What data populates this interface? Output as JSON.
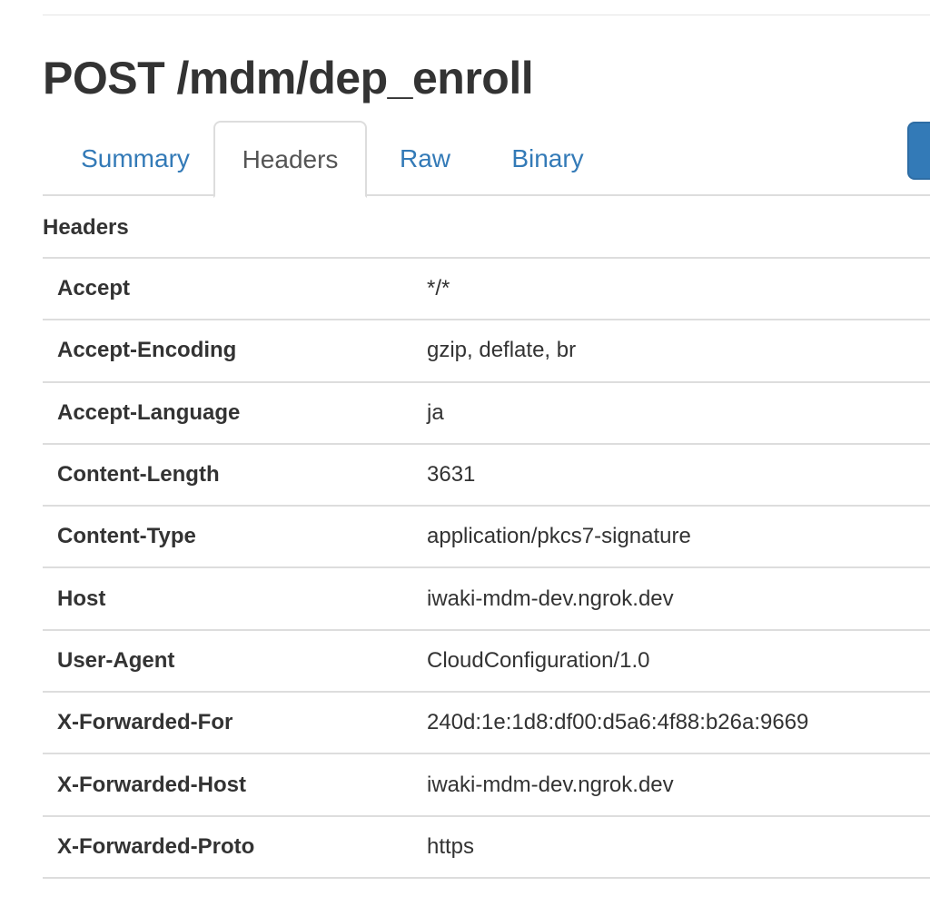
{
  "page": {
    "title": "POST /mdm/dep_enroll"
  },
  "tabs": [
    {
      "label": "Summary",
      "active": false
    },
    {
      "label": "Headers",
      "active": true
    },
    {
      "label": "Raw",
      "active": false
    },
    {
      "label": "Binary",
      "active": false
    }
  ],
  "section": {
    "label": "Headers"
  },
  "headers": [
    {
      "name": "Accept",
      "value": "*/*"
    },
    {
      "name": "Accept-Encoding",
      "value": "gzip, deflate, br"
    },
    {
      "name": "Accept-Language",
      "value": "ja"
    },
    {
      "name": "Content-Length",
      "value": "3631"
    },
    {
      "name": "Content-Type",
      "value": "application/pkcs7-signature"
    },
    {
      "name": "Host",
      "value": "iwaki-mdm-dev.ngrok.dev"
    },
    {
      "name": "User-Agent",
      "value": "CloudConfiguration/1.0"
    },
    {
      "name": "X-Forwarded-For",
      "value": "240d:1e:1d8:df00:d5a6:4f88:b26a:9669"
    },
    {
      "name": "X-Forwarded-Host",
      "value": "iwaki-mdm-dev.ngrok.dev"
    },
    {
      "name": "X-Forwarded-Proto",
      "value": "https"
    }
  ],
  "colors": {
    "link": "#337ab7",
    "text": "#333333",
    "border": "#dddddd",
    "button": "#337ab7"
  }
}
